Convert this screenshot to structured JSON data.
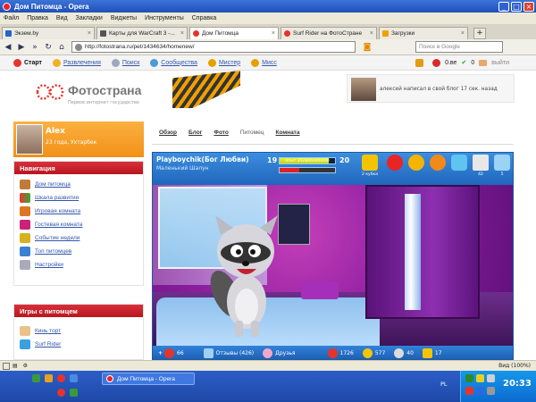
{
  "window": {
    "title": "Дом Питомца - Opera"
  },
  "menu": [
    "Файл",
    "Правка",
    "Вид",
    "Закладки",
    "Виджеты",
    "Инструменты",
    "Справка"
  ],
  "tabs": [
    {
      "label": "Экзем.by",
      "color": "#2266cc",
      "active": false
    },
    {
      "label": "Карты для WarCraft 3 -...",
      "color": "#555555",
      "active": false
    },
    {
      "label": "Дом Питомца",
      "color": "#e8332b",
      "active": true
    },
    {
      "label": "Surf Rider на ФотоСтране",
      "color": "#e8332b",
      "active": false
    },
    {
      "label": "Загрузки",
      "color": "#f0a000",
      "active": false
    }
  ],
  "address": {
    "url": "http://fotostrana.ru/pet/1434634/homenew/",
    "search_placeholder": "Поиск в Google"
  },
  "fs_toolbar": {
    "start": "Старт",
    "items": [
      "Развлечения",
      "Поиск",
      "Сообщества",
      "Мистер",
      "Мисс"
    ],
    "balance": "0.ве",
    "counter": "0",
    "logout": "выйти"
  },
  "header": {
    "logo": "Фотострана",
    "tagline": "Первое интернет государство",
    "notice": "алексей написал в свой блог 17 сек. назад"
  },
  "profile": {
    "name": "Alex",
    "info": "23 года, Ухтарбек"
  },
  "nav_panel": {
    "title": "Навигация",
    "items": [
      "Дом питомца",
      "Шкала развития",
      "Игровая комната",
      "Гостевая комната",
      "Событие недели",
      "Топ питомцев",
      "Настройки"
    ]
  },
  "games_panel": {
    "title": "Игры с питомцем",
    "items": [
      "Кинь торт",
      "Surf Rider"
    ]
  },
  "subnav": [
    "Обзор",
    "Блог",
    "Фото",
    "Питомец",
    "Комната"
  ],
  "game": {
    "pet_name": "Playboychik(Бог Любви)",
    "pet_title": "Маленький Шалун",
    "level": "19",
    "next_level": "20",
    "xp_text": "опыт 352800/400000",
    "xp_progress": 0.88,
    "hp_progress": 0.35,
    "cup_label": "2 кубка",
    "stats": [
      "42",
      "5"
    ],
    "footer": {
      "plus_value": "66",
      "reviews": "Отзывы (426)",
      "friends": "Друзья",
      "v1": "1726",
      "v2": "577",
      "v3": "40",
      "v4": "17"
    }
  },
  "statusbar": {
    "zoom": "Вид (100%)"
  },
  "taskbar": {
    "task": "Дом Питомца - Opera",
    "lang": "PL",
    "clock": "20:33"
  },
  "colors": {
    "accent_red": "#c8202a",
    "profile_orange": "#f29c22",
    "game_blue": "#2a74c8",
    "room_purple": "#8c1ea0"
  }
}
